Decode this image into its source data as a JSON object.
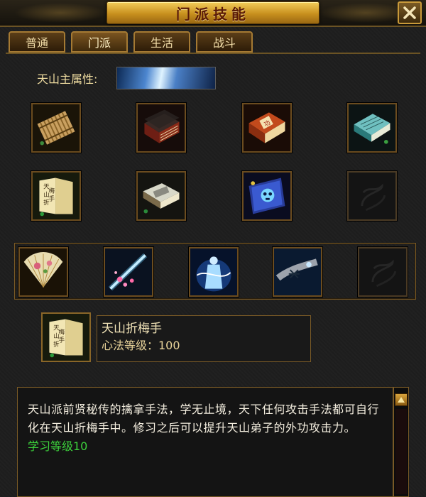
{
  "window": {
    "title": "门派技能",
    "close_icon": "close-icon"
  },
  "tabs": [
    {
      "label": "普通",
      "active": false
    },
    {
      "label": "门派",
      "active": true
    },
    {
      "label": "生活",
      "active": false
    },
    {
      "label": "战斗",
      "active": false
    }
  ],
  "main_attribute": {
    "label": "天山主属性:"
  },
  "skill_grid": {
    "row1": [
      "bamboo-scroll-icon",
      "closed-book-icon",
      "martial-arts-book-icon",
      "blue-manual-icon"
    ],
    "row2": [
      "tianshan-manual-icon",
      "open-book-icon",
      "skull-scroll-icon",
      "empty-slot-icon"
    ],
    "row3": [
      "fan-icon",
      "pink-sparkle-icon",
      "ice-figure-icon",
      "snowflake-strike-icon",
      "empty-slot-icon"
    ]
  },
  "selected_skill": {
    "icon": "tianshan-manual-icon",
    "name": "天山折梅手",
    "level_text": "心法等级：100"
  },
  "description": {
    "text": "天山派前贤秘传的擒拿手法，学无止境，天下任何攻击手法都可自行化在天山折梅手中。修习之后可以提升天山弟子的外功攻击力。",
    "requirement": "学习等级10"
  },
  "colors": {
    "gold_border": "#7a5a26",
    "title_plate": "#e2b040",
    "requirement_green": "#3cd23c"
  }
}
